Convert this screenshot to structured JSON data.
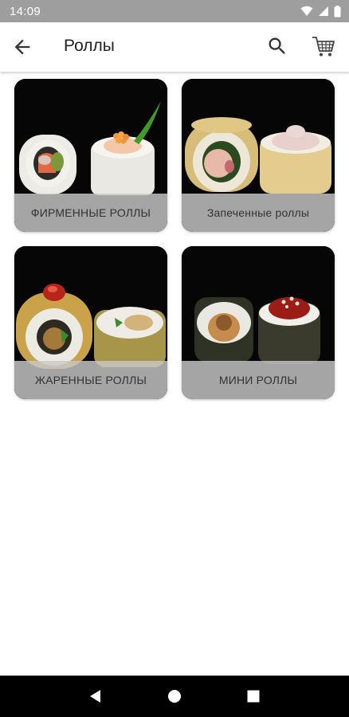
{
  "status_bar": {
    "time": "14:09",
    "icons": [
      "wifi-icon",
      "cellular-signal-icon",
      "battery-icon"
    ]
  },
  "app_bar": {
    "title": "Роллы",
    "back_icon": "arrow-back-icon",
    "search_icon": "search-icon",
    "cart_icon": "shopping-cart-icon"
  },
  "categories": [
    {
      "label": "ФИРМЕННЫЕ РОЛЛЫ"
    },
    {
      "label": "Запеченные роллы"
    },
    {
      "label": "ЖАРЕННЫЕ РОЛЛЫ"
    },
    {
      "label": "МИНИ РОЛЛЫ"
    }
  ],
  "nav_bar": {
    "icons": [
      "nav-back-icon",
      "nav-home-icon",
      "nav-recents-icon"
    ]
  },
  "colors": {
    "status_bar": "#9e9e9e",
    "label_overlay": "#c8c8c8",
    "card_background": "#060606"
  }
}
